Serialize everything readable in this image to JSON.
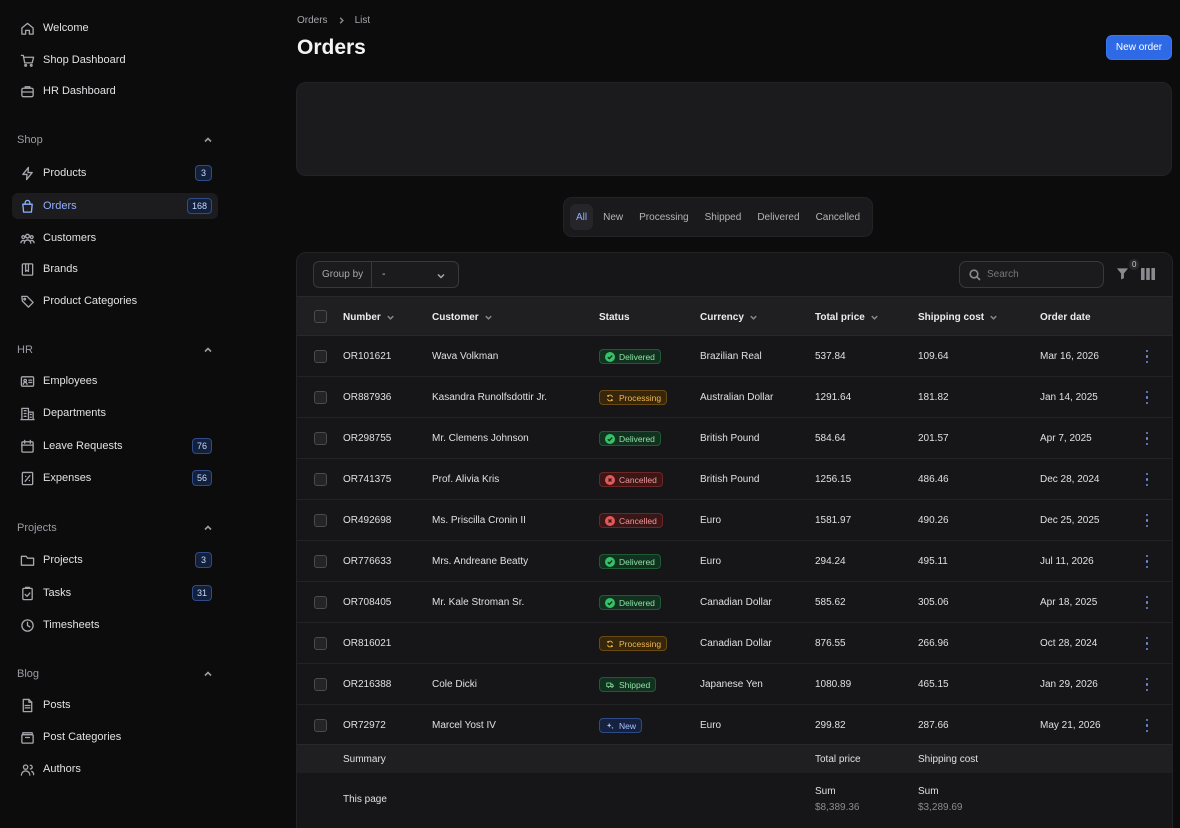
{
  "sidebar": {
    "top_items": [
      {
        "label": "Welcome",
        "icon": "home-icon"
      },
      {
        "label": "Shop Dashboard",
        "icon": "cart-icon"
      },
      {
        "label": "HR Dashboard",
        "icon": "briefcase-icon"
      }
    ],
    "groups": [
      {
        "label": "Shop",
        "items": [
          {
            "label": "Products",
            "icon": "bolt-icon",
            "badge": "3"
          },
          {
            "label": "Orders",
            "icon": "bag-icon",
            "badge": "168",
            "active": true
          },
          {
            "label": "Customers",
            "icon": "users-icon"
          },
          {
            "label": "Brands",
            "icon": "book-icon"
          },
          {
            "label": "Product Categories",
            "icon": "tag-icon"
          }
        ]
      },
      {
        "label": "HR",
        "items": [
          {
            "label": "Employees",
            "icon": "id-card-icon"
          },
          {
            "label": "Departments",
            "icon": "building-icon"
          },
          {
            "label": "Leave Requests",
            "icon": "calendar-icon",
            "badge": "76"
          },
          {
            "label": "Expenses",
            "icon": "receipt-icon",
            "badge": "56"
          }
        ]
      },
      {
        "label": "Projects",
        "items": [
          {
            "label": "Projects",
            "icon": "folder-icon",
            "badge": "3"
          },
          {
            "label": "Tasks",
            "icon": "clipboard-icon",
            "badge": "31"
          },
          {
            "label": "Timesheets",
            "icon": "clock-icon"
          }
        ]
      },
      {
        "label": "Blog",
        "items": [
          {
            "label": "Posts",
            "icon": "document-icon"
          },
          {
            "label": "Post Categories",
            "icon": "archive-icon"
          },
          {
            "label": "Authors",
            "icon": "authors-icon"
          }
        ]
      }
    ]
  },
  "header": {
    "breadcrumb": [
      "Orders",
      "List"
    ],
    "title": "Orders",
    "new_order_label": "New order"
  },
  "tabs": [
    {
      "label": "All",
      "active": true
    },
    {
      "label": "New"
    },
    {
      "label": "Processing"
    },
    {
      "label": "Shipped"
    },
    {
      "label": "Delivered"
    },
    {
      "label": "Cancelled"
    }
  ],
  "toolbar": {
    "group_by_label": "Group by",
    "group_by_value": "-",
    "search_placeholder": "Search",
    "filter_count": "0"
  },
  "table": {
    "columns": [
      "Number",
      "Customer",
      "Status",
      "Currency",
      "Total price",
      "Shipping cost",
      "Order date"
    ],
    "rows": [
      {
        "number": "OR101621",
        "customer": "Wava Volkman",
        "status": "Delivered",
        "currency": "Brazilian Real",
        "total": "537.84",
        "shipping": "109.64",
        "date": "Mar 16, 2026"
      },
      {
        "number": "OR887936",
        "customer": "Kasandra Runolfsdottir Jr.",
        "status": "Processing",
        "currency": "Australian Dollar",
        "total": "1291.64",
        "shipping": "181.82",
        "date": "Jan 14, 2025"
      },
      {
        "number": "OR298755",
        "customer": "Mr. Clemens Johnson",
        "status": "Delivered",
        "currency": "British Pound",
        "total": "584.64",
        "shipping": "201.57",
        "date": "Apr 7, 2025"
      },
      {
        "number": "OR741375",
        "customer": "Prof. Alivia Kris",
        "status": "Cancelled",
        "currency": "British Pound",
        "total": "1256.15",
        "shipping": "486.46",
        "date": "Dec 28, 2024"
      },
      {
        "number": "OR492698",
        "customer": "Ms. Priscilla Cronin II",
        "status": "Cancelled",
        "currency": "Euro",
        "total": "1581.97",
        "shipping": "490.26",
        "date": "Dec 25, 2025"
      },
      {
        "number": "OR776633",
        "customer": "Mrs. Andreane Beatty",
        "status": "Delivered",
        "currency": "Euro",
        "total": "294.24",
        "shipping": "495.11",
        "date": "Jul 11, 2026"
      },
      {
        "number": "OR708405",
        "customer": "Mr. Kale Stroman Sr.",
        "status": "Delivered",
        "currency": "Canadian Dollar",
        "total": "585.62",
        "shipping": "305.06",
        "date": "Apr 18, 2025"
      },
      {
        "number": "OR816021",
        "customer": "",
        "status": "Processing",
        "currency": "Canadian Dollar",
        "total": "876.55",
        "shipping": "266.96",
        "date": "Oct 28, 2024"
      },
      {
        "number": "OR216388",
        "customer": "Cole Dicki",
        "status": "Shipped",
        "currency": "Japanese Yen",
        "total": "1080.89",
        "shipping": "465.15",
        "date": "Jan 29, 2026"
      },
      {
        "number": "OR72972",
        "customer": "Marcel Yost IV",
        "status": "New",
        "currency": "Euro",
        "total": "299.82",
        "shipping": "287.66",
        "date": "May 21, 2026"
      }
    ]
  },
  "summary": {
    "label": "Summary",
    "total_price_label": "Total price",
    "shipping_cost_label": "Shipping cost",
    "this_page_label": "This page",
    "sum_label": "Sum",
    "total_price_sum": "$8,389.36",
    "shipping_cost_sum": "$3,289.69"
  },
  "colors": {
    "accent": "#2f6ae6",
    "active_nav": "#8fb0ff",
    "delivered": "#37c26a",
    "processing": "#f1b94e",
    "cancelled": "#e05a5a",
    "new": "#a9c2ff"
  }
}
